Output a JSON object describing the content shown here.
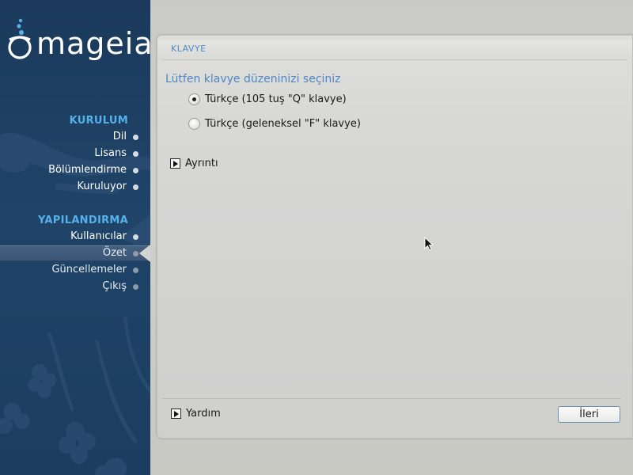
{
  "brand": {
    "name": "mageia"
  },
  "sidebar": {
    "sections": [
      {
        "title": "KURULUM",
        "steps": [
          "Dil",
          "Lisans",
          "Bölümlendirme",
          "Kuruluyor"
        ]
      },
      {
        "title": "YAPILANDIRMA",
        "steps": [
          "Kullanıcılar",
          "Özet",
          "Güncellemeler",
          "Çıkış"
        ]
      }
    ],
    "current_step": "Özet"
  },
  "panel": {
    "title": "KLAVYE",
    "question": "Lütfen klavye düzeninizi seçiniz",
    "options": [
      {
        "label": "Türkçe (105 tuş \"Q\" klavye)",
        "selected": true
      },
      {
        "label": "Türkçe (geleneksel \"F\" klavye)",
        "selected": false
      }
    ],
    "details_label": "Ayrıntı",
    "help_label": "Yardım",
    "next_label": "İleri"
  },
  "colors": {
    "sidebar_bg": "#1b3a5c",
    "accent": "#56b0ea",
    "title_blue": "#4f86c4"
  }
}
